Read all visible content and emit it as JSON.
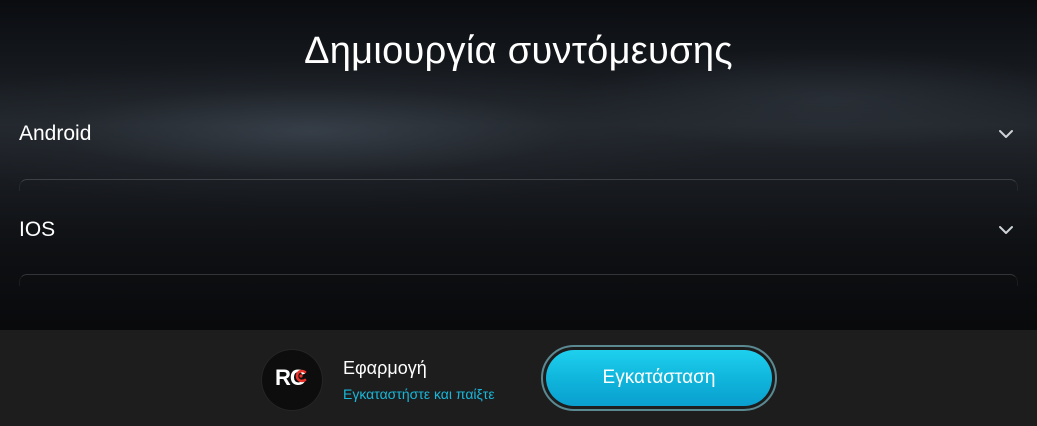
{
  "header": {
    "title": "Δημιουργία συντόμευσης"
  },
  "accordion": {
    "items": [
      {
        "label": "Android",
        "icon": "chevron-down-icon"
      },
      {
        "label": "IOS",
        "icon": "chevron-down-icon"
      }
    ]
  },
  "install_banner": {
    "logo_text": "RC",
    "app_name": "Εφαρμογή",
    "subtitle": "Εγκαταστήστε και παίξτε",
    "install_label": "Εγκατάσταση",
    "accent_color": "#18b8da",
    "logo_accent_color": "#e8342a"
  }
}
